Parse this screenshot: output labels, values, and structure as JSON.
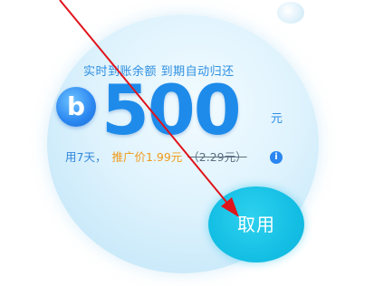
{
  "card": {
    "subtitle": "实时到账余额 到期自动归还",
    "coin_glyph": "b",
    "amount": "500",
    "unit": "元",
    "days": "用7天，",
    "promo_price": "推广价1.99元",
    "original_price": "（2.29元）",
    "info_glyph": "i",
    "claim_label": "取用"
  },
  "colors": {
    "accent_blue": "#1e8bea",
    "promo_orange": "#f09a1b",
    "button_cyan": "#14bfe4",
    "annotation_red": "#e0141b"
  }
}
